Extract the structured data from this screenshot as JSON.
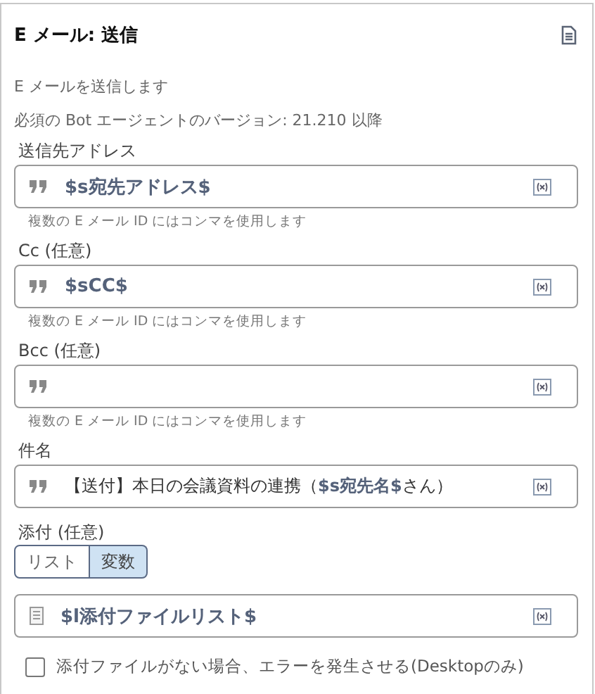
{
  "panel": {
    "title": "E メール: 送信",
    "description": "E メールを送信します",
    "requirement": "必須の Bot エージェントのバージョン: 21.210 以降"
  },
  "fields": [
    {
      "label": "送信先アドレス",
      "kind": "variable",
      "value": "$s宛先アドレス$",
      "hint": "複数の E メール ID にはコンマを使用します"
    },
    {
      "label": "Cc (任意)",
      "kind": "variable",
      "value": "$sCC$",
      "hint": "複数の E メール ID にはコンマを使用します"
    },
    {
      "label": "Bcc (任意)",
      "kind": "empty",
      "hint": "複数の E メール ID にはコンマを使用します"
    },
    {
      "label": "件名",
      "kind": "text",
      "value": "【送付】本日の会議資料の連携（**$s宛先名$**さん）"
    }
  ],
  "attachment": {
    "label": "添付 (任意)",
    "options": [
      {
        "label": "リスト",
        "selected": false
      },
      {
        "label": "変数",
        "selected": true
      }
    ],
    "value": "$l添付ファイルリスト$"
  },
  "error_option": {
    "label": "添付ファイルがない場合、エラーを発生させる(Desktopのみ)",
    "checked": false
  }
}
